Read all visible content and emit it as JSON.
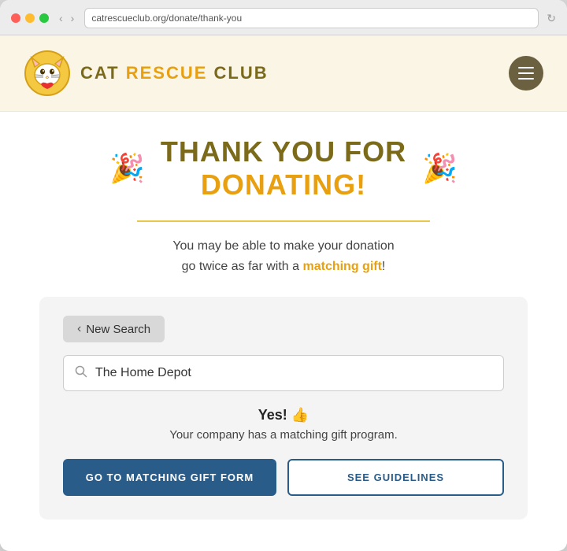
{
  "browser": {
    "address": "catrescueclub.org/donate/thank-you"
  },
  "header": {
    "logo_text_cat": "CAT ",
    "logo_text_rescue": "RESCUE",
    "logo_text_club": " CLUB",
    "menu_label": "Menu"
  },
  "main": {
    "thank_you_dark": "THANK YOU FOR",
    "thank_you_orange": "DONATING!",
    "divider": true,
    "subtitle_part1": "You may be able to make your donation",
    "subtitle_part2": "go twice as far with a",
    "subtitle_link": "matching gift",
    "subtitle_end": "!",
    "search_card": {
      "new_search_label": "New Search",
      "search_placeholder": "The Home Depot",
      "result_yes": "Yes! 👍",
      "result_desc": "Your company has a matching gift program.",
      "btn_primary": "GO TO MATCHING GIFT FORM",
      "btn_secondary": "SEE GUIDELINES"
    }
  }
}
